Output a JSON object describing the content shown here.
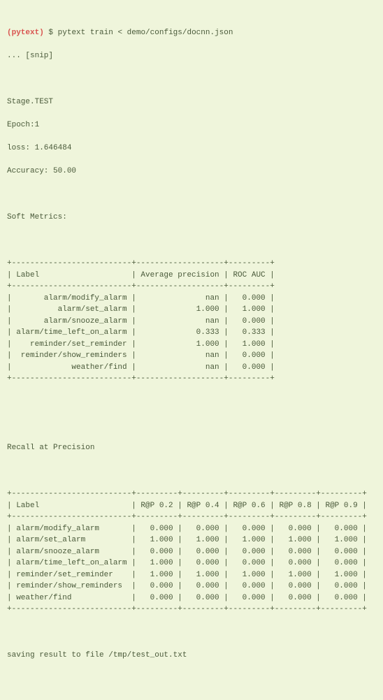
{
  "prompt": "(pytext)",
  "dollar": "$",
  "command": "pytext train < demo/configs/docnn.json",
  "snip": "... [snip]",
  "stage": "Stage.TEST",
  "epoch": "Epoch:1",
  "loss": "loss: 1.646484",
  "accuracy": "Accuracy: 50.00",
  "soft_metrics_title": "Soft Metrics:",
  "soft_table": {
    "headers": [
      "Label",
      "Average precision",
      "ROC AUC"
    ],
    "rows": [
      {
        "label": "alarm/modify_alarm",
        "ap": "nan",
        "roc": "0.000"
      },
      {
        "label": "alarm/set_alarm",
        "ap": "1.000",
        "roc": "1.000"
      },
      {
        "label": "alarm/snooze_alarm",
        "ap": "nan",
        "roc": "0.000"
      },
      {
        "label": "alarm/time_left_on_alarm",
        "ap": "0.333",
        "roc": "0.333"
      },
      {
        "label": "reminder/set_reminder",
        "ap": "1.000",
        "roc": "1.000"
      },
      {
        "label": "reminder/show_reminders",
        "ap": "nan",
        "roc": "0.000"
      },
      {
        "label": "weather/find",
        "ap": "nan",
        "roc": "0.000"
      }
    ]
  },
  "recall_title": "Recall at Precision",
  "recall_table": {
    "headers": [
      "Label",
      "R@P 0.2",
      "R@P 0.4",
      "R@P 0.6",
      "R@P 0.8",
      "R@P 0.9"
    ],
    "rows": [
      {
        "label": "alarm/modify_alarm",
        "v": [
          "0.000",
          "0.000",
          "0.000",
          "0.000",
          "0.000"
        ]
      },
      {
        "label": "alarm/set_alarm",
        "v": [
          "1.000",
          "1.000",
          "1.000",
          "1.000",
          "1.000"
        ]
      },
      {
        "label": "alarm/snooze_alarm",
        "v": [
          "0.000",
          "0.000",
          "0.000",
          "0.000",
          "0.000"
        ]
      },
      {
        "label": "alarm/time_left_on_alarm",
        "v": [
          "1.000",
          "0.000",
          "0.000",
          "0.000",
          "0.000"
        ]
      },
      {
        "label": "reminder/set_reminder",
        "v": [
          "1.000",
          "1.000",
          "1.000",
          "1.000",
          "1.000"
        ]
      },
      {
        "label": "reminder/show_reminders",
        "v": [
          "0.000",
          "0.000",
          "0.000",
          "0.000",
          "0.000"
        ]
      },
      {
        "label": "weather/find",
        "v": [
          "0.000",
          "0.000",
          "0.000",
          "0.000",
          "0.000"
        ]
      }
    ]
  },
  "saving": "saving result to file /tmp/test_out.txt",
  "chart_data": [
    {
      "type": "table",
      "title": "Soft Metrics",
      "columns": [
        "Label",
        "Average precision",
        "ROC AUC"
      ],
      "rows": [
        [
          "alarm/modify_alarm",
          "nan",
          0.0
        ],
        [
          "alarm/set_alarm",
          1.0,
          1.0
        ],
        [
          "alarm/snooze_alarm",
          "nan",
          0.0
        ],
        [
          "alarm/time_left_on_alarm",
          0.333,
          0.333
        ],
        [
          "reminder/set_reminder",
          1.0,
          1.0
        ],
        [
          "reminder/show_reminders",
          "nan",
          0.0
        ],
        [
          "weather/find",
          "nan",
          0.0
        ]
      ]
    },
    {
      "type": "table",
      "title": "Recall at Precision",
      "columns": [
        "Label",
        "R@P 0.2",
        "R@P 0.4",
        "R@P 0.6",
        "R@P 0.8",
        "R@P 0.9"
      ],
      "rows": [
        [
          "alarm/modify_alarm",
          0.0,
          0.0,
          0.0,
          0.0,
          0.0
        ],
        [
          "alarm/set_alarm",
          1.0,
          1.0,
          1.0,
          1.0,
          1.0
        ],
        [
          "alarm/snooze_alarm",
          0.0,
          0.0,
          0.0,
          0.0,
          0.0
        ],
        [
          "alarm/time_left_on_alarm",
          1.0,
          0.0,
          0.0,
          0.0,
          0.0
        ],
        [
          "reminder/set_reminder",
          1.0,
          1.0,
          1.0,
          1.0,
          1.0
        ],
        [
          "reminder/show_reminders",
          0.0,
          0.0,
          0.0,
          0.0,
          0.0
        ],
        [
          "weather/find",
          0.0,
          0.0,
          0.0,
          0.0,
          0.0
        ]
      ]
    }
  ]
}
